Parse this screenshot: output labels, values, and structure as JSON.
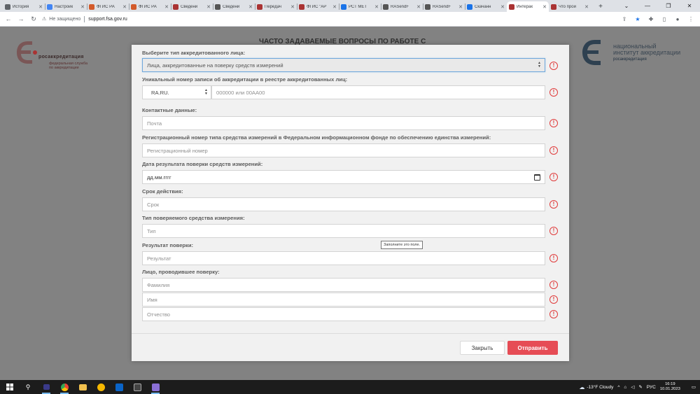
{
  "browser": {
    "tabs": [
      {
        "label": "История",
        "color": "#5f6368"
      },
      {
        "label": "Настройк",
        "color": "#4285f4"
      },
      {
        "label": "ФГИС РА",
        "color": "#d35a2a"
      },
      {
        "label": "ФГИС РА",
        "color": "#d35a2a"
      },
      {
        "label": "Сведени",
        "color": "#a33"
      },
      {
        "label": "Сведени",
        "color": "#555"
      },
      {
        "label": "Передач",
        "color": "#a33"
      },
      {
        "label": "ФГИС \"АР",
        "color": "#a33"
      },
      {
        "label": "РСТ МЕТ",
        "color": "#1a73e8"
      },
      {
        "label": "RASendF",
        "color": "#555"
      },
      {
        "label": "RASendF",
        "color": "#555"
      },
      {
        "label": "Скачанн",
        "color": "#1a73e8"
      },
      {
        "label": "Интерак",
        "color": "#a33"
      },
      {
        "label": "Что прои",
        "color": "#a33"
      }
    ],
    "active_tab_index": 12,
    "new_tab": "+",
    "insecure_label": "Не защищено",
    "url": "support.fsa.gov.ru"
  },
  "page": {
    "heading": "ЧАСТО ЗАДАВАЕМЫЕ ВОПРОСЫ ПО РАБОТЕ С",
    "left_logo": {
      "name": "росаккредитация",
      "sub1": "федеральная служба",
      "sub2": "по аккредитации"
    },
    "right_logo": {
      "line1": "национальный",
      "line2": "институт аккредитации",
      "line3": "росаккредитация"
    }
  },
  "form": {
    "type_label": "Выберите тип аккредитованного лица:",
    "type_value": "Лица, аккредитованные на поверку средств измерений",
    "number_label": "Уникальный номер записи об аккредитации в реестре аккредитованных лиц:",
    "number_prefix": "RA.RU.",
    "number_placeholder": "000000 или 00АА00",
    "contacts_label": "Контактные данные:",
    "email_placeholder": "Почта",
    "regnum_label": "Регистрационный номер типа средства измерений в Федеральном информационном фонде по обеспечению единства измерений:",
    "regnum_placeholder": "Регистрационный номер",
    "date_label": "Дата результата поверки средств измерений:",
    "date_placeholder": "дд.мм.гггг",
    "term_label": "Срок действия:",
    "term_placeholder": "Срок",
    "devtype_label": "Тип поверяемого средства измерения:",
    "devtype_placeholder": "Тип",
    "result_label": "Результат поверки:",
    "result_placeholder": "Результат",
    "person_label": "Лицо, проводившее поверку:",
    "surname_placeholder": "Фамилия",
    "name_placeholder": "Имя",
    "patronymic_placeholder": "Отчество",
    "tooltip": "Заполните это поле.",
    "error_glyph": "!",
    "close_label": "Закрыть",
    "submit_label": "Отправить"
  },
  "taskbar": {
    "weather": "-13°F Cloudy",
    "language": "РУС",
    "time": "16:19",
    "date": "10.01.2023"
  }
}
